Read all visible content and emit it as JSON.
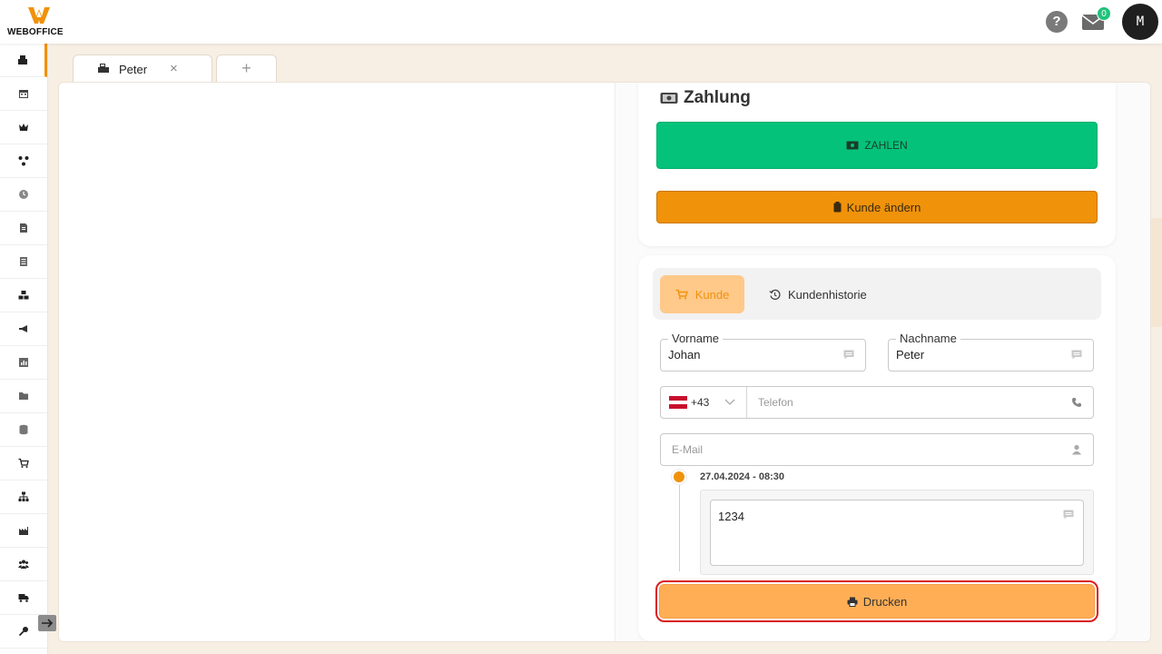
{
  "app": {
    "logo_text": "WEBOFFICE",
    "avatar_initial": "M",
    "mail_count": "0"
  },
  "colors": {
    "accent": "#f0920a",
    "pay_green": "#05c27a",
    "print_orange": "#ffae55",
    "highlight_red": "#d91d1d"
  },
  "sidebar": {
    "items": [
      {
        "icon": "cash-register-icon"
      },
      {
        "icon": "calendar-icon"
      },
      {
        "icon": "crown-icon"
      },
      {
        "icon": "network-icon"
      },
      {
        "icon": "clock-icon"
      },
      {
        "icon": "document-icon"
      },
      {
        "icon": "list-icon"
      },
      {
        "icon": "boxes-icon"
      },
      {
        "icon": "megaphone-icon"
      },
      {
        "icon": "chart-icon"
      },
      {
        "icon": "folder-icon"
      },
      {
        "icon": "database-icon"
      },
      {
        "icon": "cart-icon"
      },
      {
        "icon": "hierarchy-icon"
      },
      {
        "icon": "industry-icon"
      },
      {
        "icon": "users-icon"
      },
      {
        "icon": "truck-icon"
      },
      {
        "icon": "key-icon"
      }
    ]
  },
  "tabs": {
    "active_label": "Peter",
    "close_symbol": "×",
    "add_symbol": "+"
  },
  "payment": {
    "title": "Zahlung",
    "pay_button": "ZAHLEN",
    "change_customer_button": "Kunde ändern"
  },
  "customer": {
    "tab_customer": "Kunde",
    "tab_history": "Kundenhistorie",
    "first_name_label": "Vorname",
    "first_name_value": "Johan",
    "last_name_label": "Nachname",
    "last_name_value": "Peter",
    "phone_prefix": "+43",
    "phone_placeholder": "Telefon",
    "email_placeholder": "E-Mail",
    "note_date": "27.04.2024 - 08:30",
    "note_text": "1234",
    "print_button": "Drucken"
  }
}
